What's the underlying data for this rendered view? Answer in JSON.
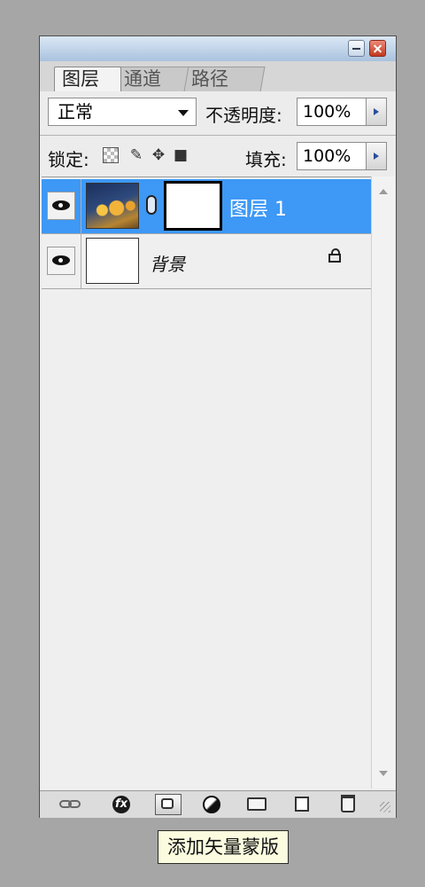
{
  "tabs": [
    {
      "label": "图层"
    },
    {
      "label": "通道"
    },
    {
      "label": "路径"
    }
  ],
  "blend": {
    "value": "正常"
  },
  "opacity": {
    "label": "不透明度:",
    "value": "100%"
  },
  "lock": {
    "label": "锁定:"
  },
  "fill": {
    "label": "填充:",
    "value": "100%"
  },
  "layers": [
    {
      "name": "图层 1",
      "selected": true
    },
    {
      "name": "背景",
      "locked": true
    }
  ],
  "bottom": {
    "fx_label": "fx"
  },
  "tooltip": {
    "text": "添加矢量蒙版"
  },
  "colors": {
    "selection": "#3d98f6",
    "panel_bg": "#ececec",
    "desktop": "#a6a6a6"
  }
}
